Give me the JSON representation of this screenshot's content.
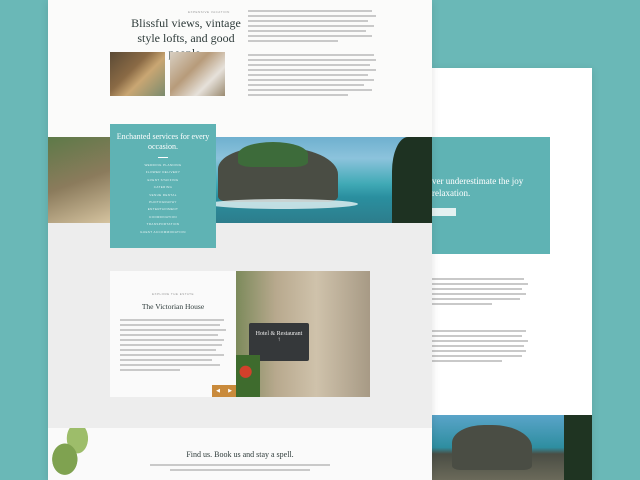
{
  "front": {
    "hero": {
      "kicker": "expensive vacation",
      "title": "Blissful views, vintage style lofts, and good people."
    },
    "services": {
      "title": "Enchanted services for every occasion.",
      "items": [
        "Wedding Planning",
        "Flower Delivery",
        "Event Staffing",
        "Catering",
        "Venue Rental",
        "Photography",
        "Entertainment",
        "Coordination",
        "Transportation",
        "Guest Accommodation"
      ]
    },
    "victorian": {
      "kicker": "explore the estate",
      "title": "The Victorian House",
      "sign_text": "Hotel & Restaurant",
      "prev_arrow": "◀",
      "next_arrow": "▶"
    },
    "find": {
      "title": "Find us. Book us and stay a spell."
    }
  },
  "back": {
    "banner_title": "ver underestimate the joy relaxation."
  },
  "colors": {
    "background": "#6ab8b7",
    "teal_panel": "#5fb3b4",
    "arrow_button": "#c98a3b"
  }
}
